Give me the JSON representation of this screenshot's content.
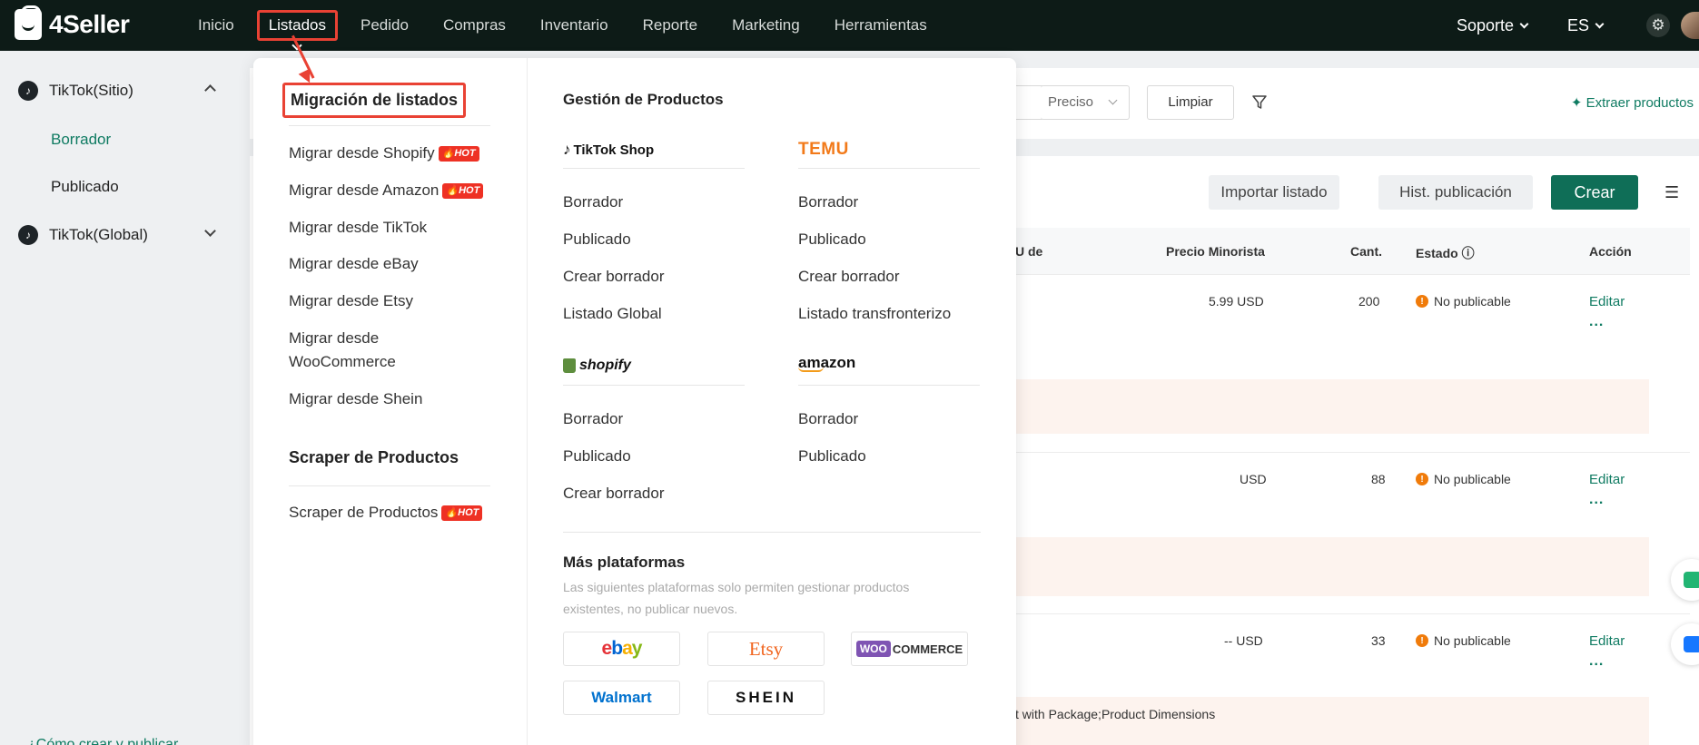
{
  "topbar": {
    "brand": "4Seller",
    "nav": [
      "Inicio",
      "Listados",
      "Pedido",
      "Compras",
      "Inventario",
      "Reporte",
      "Marketing",
      "Herramientas"
    ],
    "support": "Soporte",
    "lang": "ES"
  },
  "sidebar": {
    "groups": [
      {
        "label": "TikTok(Sitio)",
        "items": [
          "Borrador",
          "Publicado"
        ]
      },
      {
        "label": "TikTok(Global)"
      }
    ],
    "help_link": "¿Cómo crear y publicar..."
  },
  "toolbar": {
    "select_value": "Preciso",
    "clear_label": "Limpiar",
    "extract_label": "Extraer productos",
    "import_label": "Importar listado",
    "history_label": "Hist. publicación",
    "create_label": "Crear"
  },
  "table": {
    "headers": [
      "U de",
      "Precio Minorista",
      "Cant.",
      "Estado",
      "Acción"
    ],
    "rows": [
      {
        "price": "5.99 USD",
        "qty": "200",
        "status": "No publicable",
        "action": "Editar",
        "more": "..."
      },
      {
        "price": "USD",
        "qty": "88",
        "status": "No publicable",
        "action": "Editar",
        "more": "..."
      },
      {
        "price": "-- USD",
        "qty": "33",
        "status": "No publicable",
        "action": "Editar",
        "more": "..."
      }
    ],
    "band_text": "t with Package;Product Dimensions"
  },
  "dropdown": {
    "migration_title": "Migración de listados",
    "migration_items": [
      {
        "label": "Migrar desde Shopify",
        "hot": true
      },
      {
        "label": "Migrar desde Amazon",
        "hot": true
      },
      {
        "label": "Migrar desde TikTok",
        "hot": false
      },
      {
        "label": "Migrar desde eBay",
        "hot": false
      },
      {
        "label": "Migrar desde Etsy",
        "hot": false
      },
      {
        "label": "Migrar desde WooCommerce",
        "hot": false
      },
      {
        "label": "Migrar desde Shein",
        "hot": false
      }
    ],
    "scraper_title": "Scraper de Productos",
    "scraper_items": [
      {
        "label": "Scraper de Productos",
        "hot": true
      }
    ],
    "hot_badge": "HOT",
    "management_title": "Gestión de Productos",
    "platforms": {
      "tiktok": {
        "logo": "TikTok Shop",
        "links": [
          "Borrador",
          "Publicado",
          "Crear borrador",
          "Listado Global"
        ]
      },
      "temu": {
        "logo": "TEMU",
        "links": [
          "Borrador",
          "Publicado",
          "Crear borrador",
          "Listado transfronterizo"
        ]
      },
      "shopify": {
        "logo": "shopify",
        "links": [
          "Borrador",
          "Publicado",
          "Crear borrador"
        ]
      },
      "amazon": {
        "logo": "amazon",
        "links": [
          "Borrador",
          "Publicado"
        ]
      }
    },
    "more_title": "Más plataformas",
    "more_desc": "Las siguientes plataformas solo permiten gestionar productos existentes, no publicar nuevos.",
    "more_platforms": [
      "ebay",
      "Etsy",
      "WOOCOMMERCE",
      "Walmart",
      "SHEIN"
    ]
  },
  "colors": {
    "topbar_bg": "#0d1b17",
    "accent_green": "#0f7b62",
    "primary_button": "#0f6e57",
    "highlight_red": "#e94234",
    "warning_orange": "#f07b0a"
  }
}
